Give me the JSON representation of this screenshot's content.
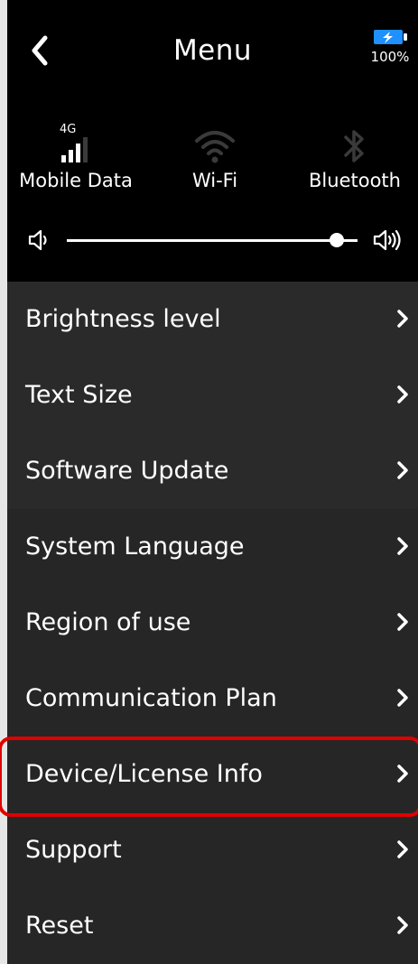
{
  "header": {
    "title": "Menu",
    "back_icon": "chevron-left-icon",
    "battery": {
      "percent_label": "100%",
      "level": 1.0,
      "charging": true,
      "accent": "#1e90ff"
    }
  },
  "connectivity": {
    "items": [
      {
        "label": "Mobile Data",
        "icon": "cellular-signal-icon",
        "badge": "4G",
        "active": true
      },
      {
        "label": "Wi-Fi",
        "icon": "wifi-icon",
        "active": false
      },
      {
        "label": "Bluetooth",
        "icon": "bluetooth-icon",
        "active": false
      }
    ]
  },
  "volume": {
    "level": 0.93,
    "min_icon": "volume-low-icon",
    "max_icon": "volume-high-icon"
  },
  "menu": {
    "items": [
      {
        "label": "Brightness level"
      },
      {
        "label": "Text Size"
      },
      {
        "label": "Software Update"
      },
      {
        "label": "System Language"
      },
      {
        "label": "Region of use"
      },
      {
        "label": "Communication Plan"
      },
      {
        "label": "Device/License Info",
        "highlighted": true
      },
      {
        "label": "Support"
      },
      {
        "label": "Reset"
      }
    ]
  },
  "colors": {
    "background": "#000000",
    "menu_background": "#2a2a2a",
    "inactive_icon": "#3a3a3a",
    "highlight": "#e00000"
  }
}
